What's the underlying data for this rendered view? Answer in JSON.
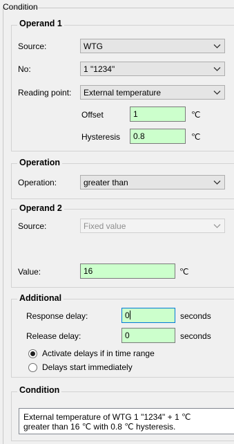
{
  "window_title": "Condition",
  "operand1": {
    "title": "Operand 1",
    "source_label": "Source:",
    "source_value": "WTG",
    "no_label": "No:",
    "no_value": "1 \"1234\"",
    "reading_point_label": "Reading point:",
    "reading_point_value": "External temperature",
    "offset_label": "Offset",
    "offset_value": "1",
    "offset_unit": "℃",
    "hysteresis_label": "Hysteresis",
    "hysteresis_value": "0.8",
    "hysteresis_unit": "℃"
  },
  "operation": {
    "title": "Operation",
    "label": "Operation:",
    "value": "greater than"
  },
  "operand2": {
    "title": "Operand 2",
    "source_label": "Source:",
    "source_value": "Fixed value",
    "value_label": "Value:",
    "value": "16",
    "unit": "℃"
  },
  "additional": {
    "title": "Additional",
    "response_delay_label": "Response delay:",
    "response_delay_value": "0",
    "release_delay_label": "Release delay:",
    "release_delay_value": "0",
    "seconds_label": "seconds",
    "radio_time_range": "Activate delays if in time range",
    "radio_immediate": "Delays start immediately",
    "selected_radio": "time_range"
  },
  "condition": {
    "title": "Condition",
    "text_line1": "External temperature of WTG 1 \"1234\" + 1 ℃",
    "text_line2": "greater than 16 ℃ with  0.8 ℃ hysteresis."
  },
  "colors": {
    "input_bg": "#ccffcc",
    "focus_border": "#0078d7",
    "window_bg": "#f0f0f0"
  }
}
